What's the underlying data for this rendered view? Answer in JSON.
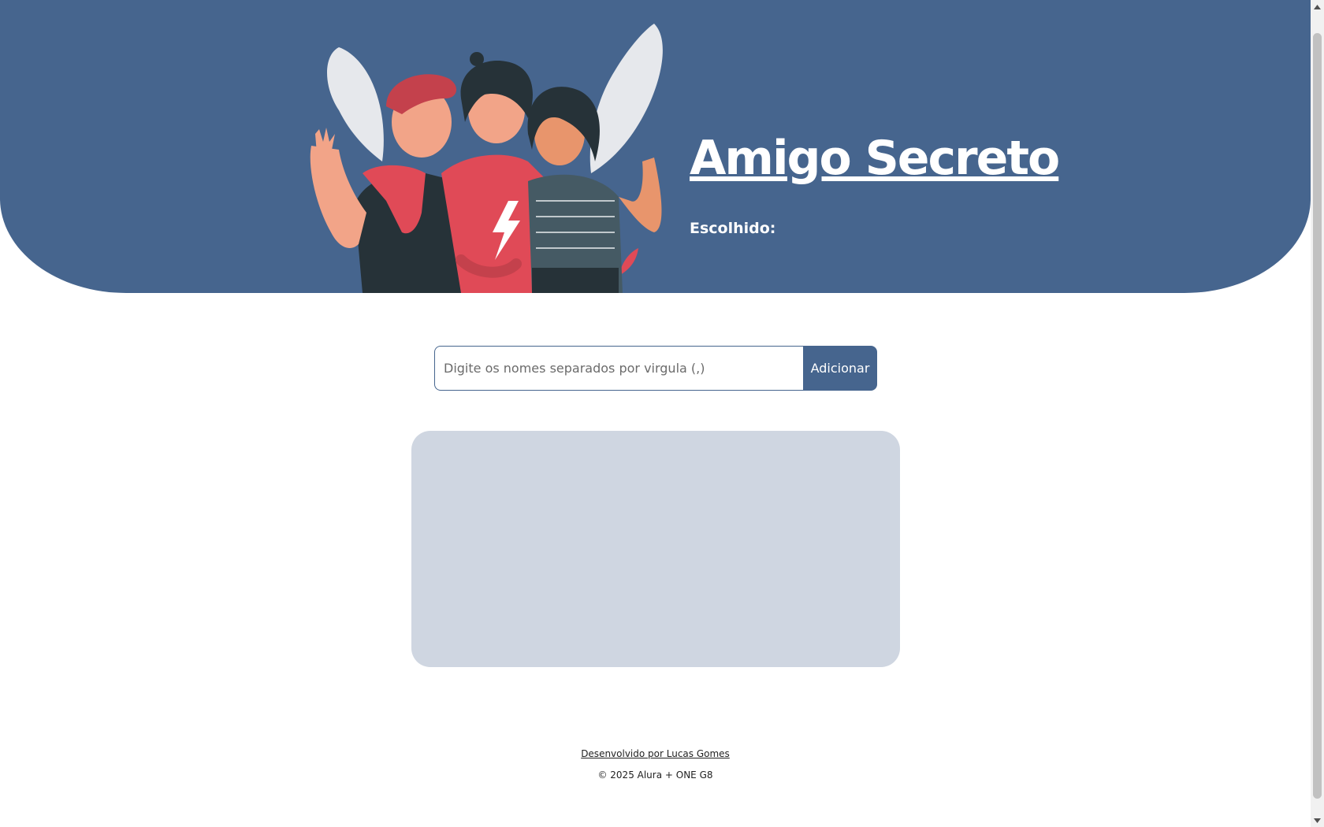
{
  "header": {
    "title": "Amigo Secreto",
    "chosen_label": "Escolhido:",
    "illustration": "three-friends-illustration"
  },
  "form": {
    "input_placeholder": "Digite os nomes separados por virgula (,)",
    "input_value": "",
    "add_button_label": "Adicionar"
  },
  "footer": {
    "credit_link": "Desenvolvido por Lucas Gomes",
    "copyright": "© 2025 Alura + ONE G8"
  },
  "colors": {
    "banner": "#46658e",
    "list_box": "#cfd6e1",
    "button": "#46658e",
    "shirt_red": "#e04a57"
  }
}
